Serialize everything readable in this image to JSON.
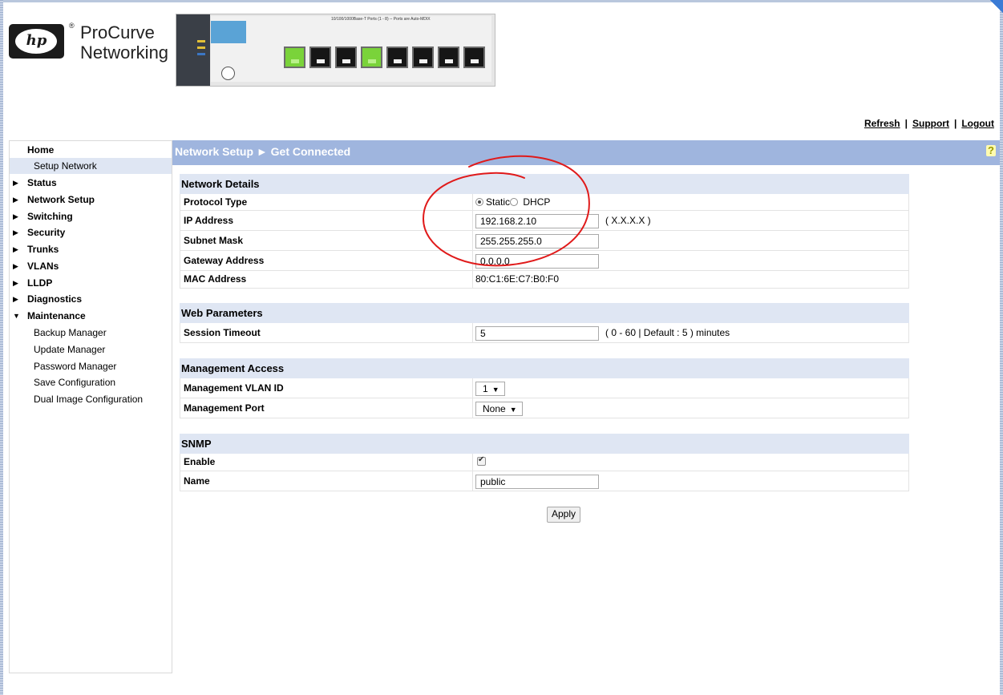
{
  "header": {
    "brand_line1": "ProCurve",
    "brand_line2": "Networking",
    "registered_mark": "®",
    "logo_text": "hp",
    "switch_port_caption": "10/100/1000Base-T Ports (1 - 8) -- Ports are Auto-MDIX",
    "switch_ports_green": [
      1,
      4
    ],
    "switch_ports_count": 8
  },
  "top_links": {
    "refresh": "Refresh",
    "support": "Support",
    "logout": "Logout",
    "separator": "|"
  },
  "sidebar": {
    "items": [
      {
        "label": "Home",
        "arrow": ""
      },
      {
        "label": "Setup Network",
        "sub": true,
        "active": true
      },
      {
        "label": "Status",
        "arrow": "▶"
      },
      {
        "label": "Network Setup",
        "arrow": "▶"
      },
      {
        "label": "Switching",
        "arrow": "▶"
      },
      {
        "label": "Security",
        "arrow": "▶"
      },
      {
        "label": "Trunks",
        "arrow": "▶"
      },
      {
        "label": "VLANs",
        "arrow": "▶"
      },
      {
        "label": "LLDP",
        "arrow": "▶"
      },
      {
        "label": "Diagnostics",
        "arrow": "▶"
      },
      {
        "label": "Maintenance",
        "arrow": "▼"
      },
      {
        "label": "Backup Manager",
        "sub": true
      },
      {
        "label": "Update Manager",
        "sub": true
      },
      {
        "label": "Password Manager",
        "sub": true
      },
      {
        "label": "Save Configuration",
        "sub": true
      },
      {
        "label": "Dual Image Configuration",
        "sub": true
      }
    ]
  },
  "page": {
    "title": "Network Setup ► Get Connected",
    "help_icon": "?"
  },
  "network_details": {
    "heading": "Network Details",
    "protocol_label": "Protocol Type",
    "protocol_static": "Static",
    "protocol_dhcp": "DHCP",
    "protocol_selected": "Static",
    "ip_label": "IP Address",
    "ip_value": "192.168.2.10",
    "ip_hint": "( X.X.X.X )",
    "subnet_label": "Subnet Mask",
    "subnet_value": "255.255.255.0",
    "gateway_label": "Gateway Address",
    "gateway_value": "0.0.0.0",
    "mac_label": "MAC Address",
    "mac_value": "80:C1:6E:C7:B0:F0"
  },
  "web_parameters": {
    "heading": "Web Parameters",
    "session_label": "Session Timeout",
    "session_value": "5",
    "session_hint": "( 0 - 60 | Default : 5 ) minutes"
  },
  "management_access": {
    "heading": "Management Access",
    "vlan_label": "Management VLAN ID",
    "vlan_value": "1",
    "port_label": "Management Port",
    "port_value": "None"
  },
  "snmp": {
    "heading": "SNMP",
    "enable_label": "Enable",
    "enable_checked": true,
    "name_label": "Name",
    "name_value": "public"
  },
  "actions": {
    "apply": "Apply"
  },
  "annotation_color": "#e01a1a"
}
